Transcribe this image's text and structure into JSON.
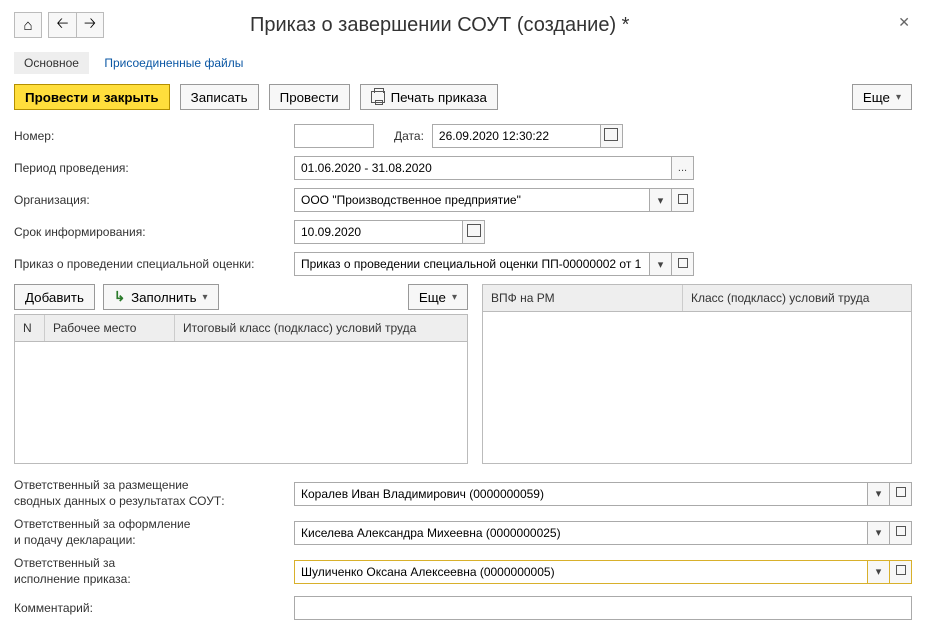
{
  "window": {
    "title": "Приказ о завершении СОУТ (создание) *"
  },
  "tabs": {
    "main": "Основное",
    "files": "Присоединенные файлы"
  },
  "toolbar": {
    "post_close": "Провести и закрыть",
    "save": "Записать",
    "post": "Провести",
    "print": "Печать приказа",
    "more": "Еще"
  },
  "fields": {
    "number_label": "Номер:",
    "number_value": "",
    "date_label": "Дата:",
    "date_value": "26.09.2020 12:30:22",
    "period_label": "Период проведения:",
    "period_value": "01.06.2020 - 31.08.2020",
    "org_label": "Организация:",
    "org_value": "ООО \"Производственное предприятие\"",
    "inform_label": "Срок информирования:",
    "inform_value": "10.09.2020",
    "order_label": "Приказ о проведении специальной оценки:",
    "order_value": "Приказ о проведении специальной оценки ПП-00000002 от 1"
  },
  "subtool": {
    "add": "Добавить",
    "fill": "Заполнить",
    "more": "Еще"
  },
  "table_left": {
    "col_n": "N",
    "col_workplace": "Рабочее место",
    "col_class": "Итоговый класс (подкласс) условий труда"
  },
  "table_right": {
    "col_vpf": "ВПФ на РМ",
    "col_class": "Класс (подкласс) условий труда"
  },
  "resp": {
    "l1a": "Ответственный за размещение",
    "l1b": "сводных данных о результатах СОУТ:",
    "v1": "Коралев Иван Владимирович (0000000059)",
    "l2a": "Ответственный за оформление",
    "l2b": "и подачу декларации:",
    "v2": "Киселева Александра Михеевна (0000000025)",
    "l3a": "Ответственный за",
    "l3b": "исполнение приказа:",
    "v3": "Шуличенко Оксана Алексеевна (0000000005)",
    "comment_label": "Комментарий:",
    "comment_value": ""
  },
  "icons": {
    "home": "⌂",
    "back": "🡠",
    "fwd": "🡢",
    "close": "✕",
    "ellipsis": "..."
  }
}
